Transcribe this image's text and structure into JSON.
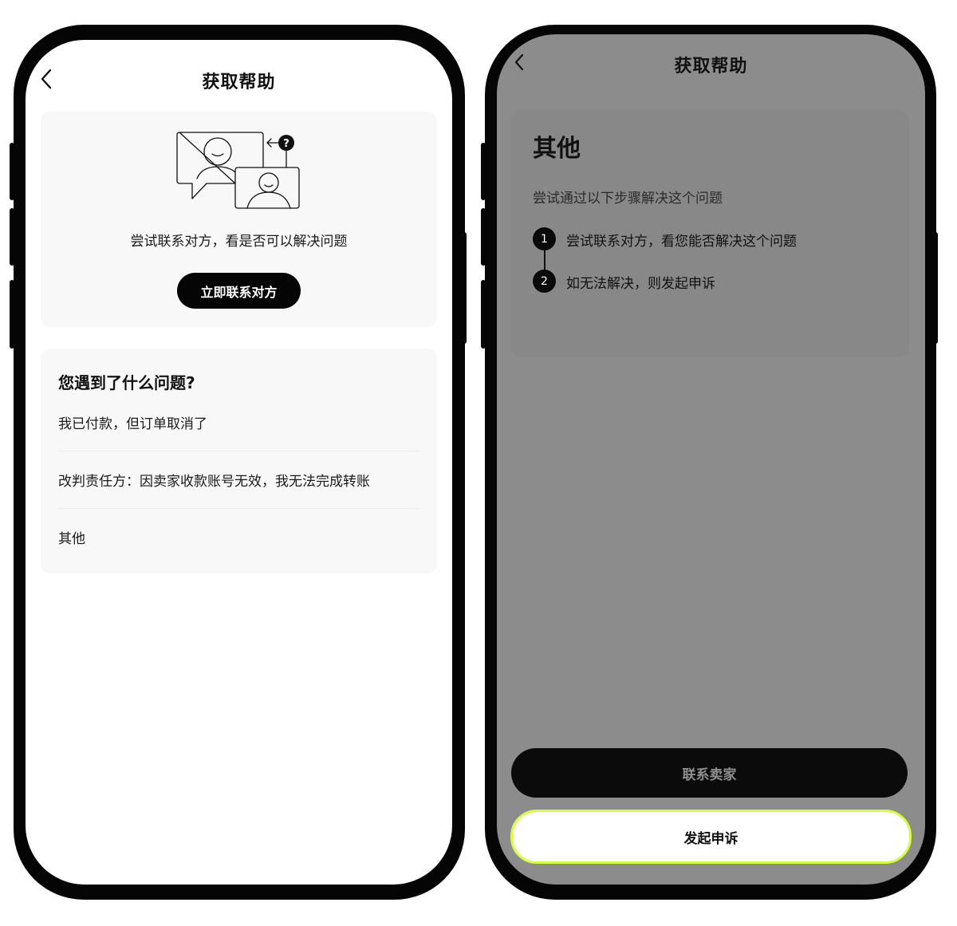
{
  "left_screen": {
    "header": {
      "title": "获取帮助",
      "back_icon": "chevron-left-icon"
    },
    "contact_card": {
      "illustration": "video-chat-help-icon",
      "hint": "尝试联系对方，看是否可以解决问题",
      "button_label": "立即联系对方"
    },
    "problem_card": {
      "title": "您遇到了什么问题?",
      "items": [
        {
          "label": "我已付款，但订单取消了"
        },
        {
          "label": "改判责任方：因卖家收款账号无效，我无法完成转账"
        },
        {
          "label": "其他"
        }
      ]
    }
  },
  "right_screen": {
    "header": {
      "title": "获取帮助",
      "back_icon": "chevron-left-icon"
    },
    "overlay_color": "#8c8c8c",
    "title": "其他",
    "subtitle": "尝试通过以下步骤解决这个问题",
    "steps": [
      {
        "number": "1",
        "text": "尝试联系对方，看您能否解决这个问题"
      },
      {
        "number": "2",
        "text": "如无法解决，则发起申诉"
      }
    ],
    "buttons": {
      "contact_seller": "联系卖家",
      "appeal": "发起申诉"
    },
    "appeal_border_color": "#d4ff3a"
  }
}
